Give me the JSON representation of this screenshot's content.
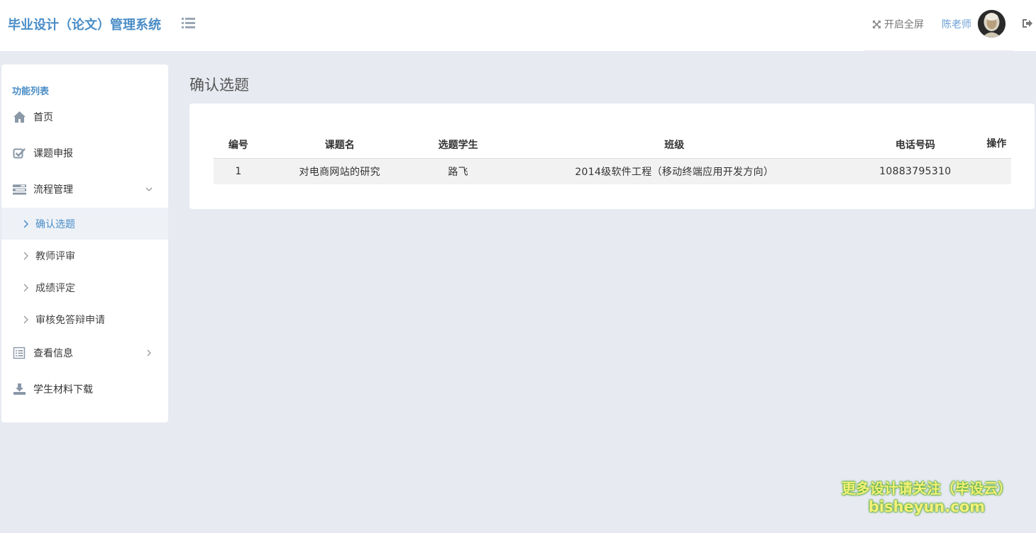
{
  "header": {
    "brand": "毕业设计（论文）管理系统",
    "fullscreen_label": "开启全屏",
    "username": "陈老师",
    "icons": {
      "menu": "list-icon",
      "fullscreen": "expand-icon",
      "logout": "sign-out-icon"
    }
  },
  "sidebar": {
    "heading": "功能列表",
    "items": [
      {
        "label": "首页",
        "icon": "home-icon"
      },
      {
        "label": "课题申报",
        "icon": "check-square-icon"
      },
      {
        "label": "流程管理",
        "icon": "tasks-icon",
        "expanded": true
      },
      {
        "label": "查看信息",
        "icon": "list-alt-icon",
        "expanded": false
      },
      {
        "label": "学生材料下载",
        "icon": "download-icon"
      }
    ],
    "subitems": [
      {
        "label": "确认选题",
        "active": true
      },
      {
        "label": "教师评审",
        "active": false
      },
      {
        "label": "成绩评定",
        "active": false
      },
      {
        "label": "审核免答辩申请",
        "active": false
      }
    ]
  },
  "main": {
    "title": "确认选题",
    "table": {
      "headers": [
        "编号",
        "课题名",
        "选题学生",
        "班级",
        "电话号码",
        "操作"
      ],
      "rows": [
        [
          "1",
          "对电商网站的研究",
          "路飞",
          "2014级软件工程（移动终端应用开发方向）",
          "10883795310",
          ""
        ]
      ]
    }
  },
  "watermark": {
    "line1": "更多设计请关注（毕设云）",
    "line2": "bisheyun.com"
  },
  "colors": {
    "accent": "#4a8dc7",
    "background": "#e8eaf2",
    "active_row": "#eef2f7"
  }
}
